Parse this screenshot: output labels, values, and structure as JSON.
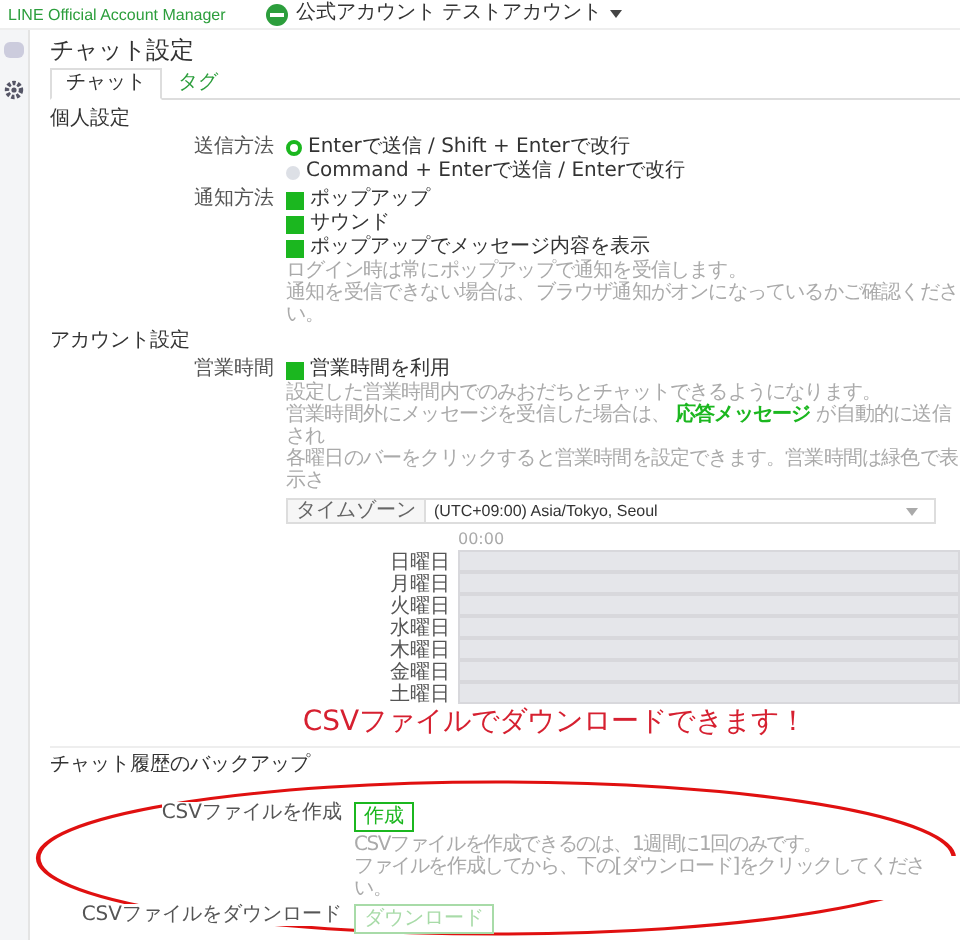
{
  "header": {
    "logo_alt": "LINE Official Account Manager",
    "account": "公式アカウント テストアカウント"
  },
  "page": {
    "title": "チャット設定"
  },
  "tabs": [
    {
      "label": "チャット",
      "selected": true
    },
    {
      "label": "タグ",
      "selected": false
    }
  ],
  "personal": {
    "heading": "個人設定",
    "send_label": "送信方法",
    "send_options": [
      {
        "label": "Enterで送信 / Shift + Enterで改行",
        "selected": true
      },
      {
        "label": "Command + Enterで送信 / Enterで改行",
        "selected": false
      }
    ],
    "notify_label": "通知方法",
    "notify_options": [
      {
        "label": "ポップアップ",
        "checked": true
      },
      {
        "label": "サウンド",
        "checked": true
      },
      {
        "label": "ポップアップでメッセージ内容を表示",
        "checked": true
      }
    ],
    "notify_help": [
      "ログイン時は常にポップアップで通知を受信します。",
      "通知を受信できない場合は、ブラウザ通知がオンになっているかご確認ください。"
    ]
  },
  "account": {
    "heading": "アカウント設定",
    "hours_label": "営業時間",
    "hours_option": {
      "label": "営業時間を利用",
      "checked": true
    },
    "help_1": "設定した営業時間内でのみおだちとチャットできるようになります。",
    "help_2": {
      "before": "営業時間外にメッセージを受信した場合は、",
      "link": "応答メッセージ",
      "after": "が自動的に送信され"
    },
    "help_3": "各曜日のバーをクリックすると営業時間を設定できます。営業時間は緑色で表示さ",
    "timezone_label": "タイムゾーン",
    "timezone_value": "(UTC+09:00) Asia/Tokyo, Seoul",
    "time_tick": "00:00",
    "days": [
      "日曜日",
      "月曜日",
      "火曜日",
      "水曜日",
      "木曜日",
      "金曜日",
      "土曜日"
    ]
  },
  "annotation": "CSVファイルでダウンロードできます！",
  "backup": {
    "heading": "チャット履歴のバックアップ",
    "create_label": "CSVファイルを作成",
    "create_button": {
      "label": "作成",
      "disabled": false
    },
    "help": [
      "CSVファイルを作成できるのは、1週間に1回のみです。",
      "ファイルを作成してから、下の[ダウンロード]をクリックしてください。"
    ],
    "download_label": "CSVファイルをダウンロード",
    "download_button": {
      "label": "ダウンロード",
      "disabled": true
    }
  }
}
